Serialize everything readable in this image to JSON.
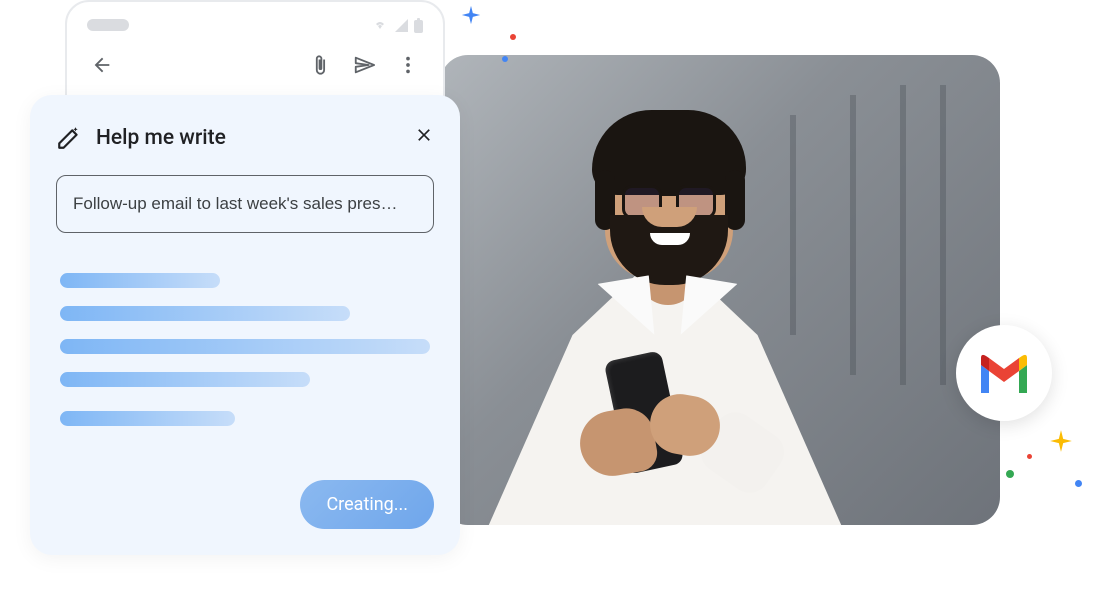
{
  "hmw": {
    "title": "Help me write",
    "prompt": "Follow-up email to last week's sales pres…",
    "status": "Creating..."
  },
  "icons": {
    "pencil": "pencil-sparkle-icon",
    "close": "close-icon",
    "back": "back-arrow-icon",
    "attach": "attach-icon",
    "send": "send-icon",
    "more": "more-icon",
    "gmail": "gmail-icon"
  },
  "colors": {
    "blue": "#4285f4",
    "red": "#ea4335",
    "yellow": "#fbbc04",
    "green": "#34a853",
    "card_bg": "#f0f6fe"
  }
}
